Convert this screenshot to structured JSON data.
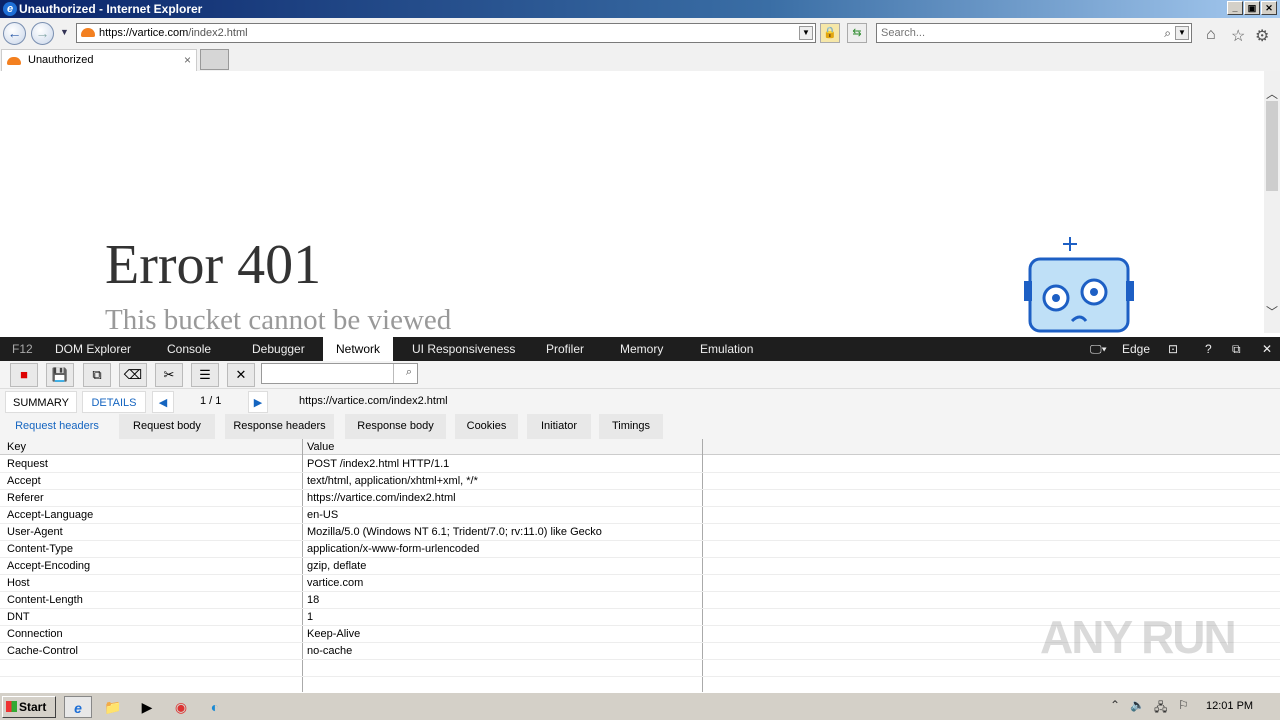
{
  "window": {
    "title": "Unauthorized - Internet Explorer",
    "min": "_",
    "max": "▣",
    "close": "✕"
  },
  "address": {
    "url_main": "https://vartice.com",
    "url_path": "/index2.html",
    "search_placeholder": "Search..."
  },
  "tab": {
    "label": "Unauthorized",
    "close": "×"
  },
  "page": {
    "heading": "Error 401",
    "subheading": "This bucket cannot be viewed"
  },
  "devtools": {
    "tabs": [
      "F12",
      "DOM Explorer",
      "Console",
      "Debugger",
      "Network",
      "UI Responsiveness",
      "Profiler",
      "Memory",
      "Emulation"
    ],
    "active_tab": "Network",
    "mode": "Edge",
    "summary_label": "SUMMARY",
    "details_label": "DETAILS",
    "page_counter": "1 / 1",
    "request_url": "https://vartice.com/index2.html",
    "subtabs": [
      "Request headers",
      "Request body",
      "Response headers",
      "Response body",
      "Cookies",
      "Initiator",
      "Timings"
    ],
    "active_subtab": "Request headers",
    "columns": {
      "key": "Key",
      "value": "Value"
    },
    "rows": [
      {
        "k": "Request",
        "v": "POST /index2.html HTTP/1.1"
      },
      {
        "k": "Accept",
        "v": "text/html, application/xhtml+xml, */*"
      },
      {
        "k": "Referer",
        "v": "https://vartice.com/index2.html"
      },
      {
        "k": "Accept-Language",
        "v": "en-US"
      },
      {
        "k": "User-Agent",
        "v": "Mozilla/5.0 (Windows NT 6.1; Trident/7.0; rv:11.0) like Gecko"
      },
      {
        "k": "Content-Type",
        "v": "application/x-www-form-urlencoded"
      },
      {
        "k": "Accept-Encoding",
        "v": "gzip, deflate"
      },
      {
        "k": "Host",
        "v": "vartice.com"
      },
      {
        "k": "Content-Length",
        "v": "18"
      },
      {
        "k": "DNT",
        "v": "1"
      },
      {
        "k": "Connection",
        "v": "Keep-Alive"
      },
      {
        "k": "Cache-Control",
        "v": "no-cache"
      }
    ]
  },
  "watermark": "ANY RUN",
  "taskbar": {
    "start": "Start",
    "clock": "12:01 PM"
  },
  "colors": {
    "accent": "#1565c0",
    "cloudflare": "#f38020",
    "devtools_dark": "#1e1e1e"
  }
}
